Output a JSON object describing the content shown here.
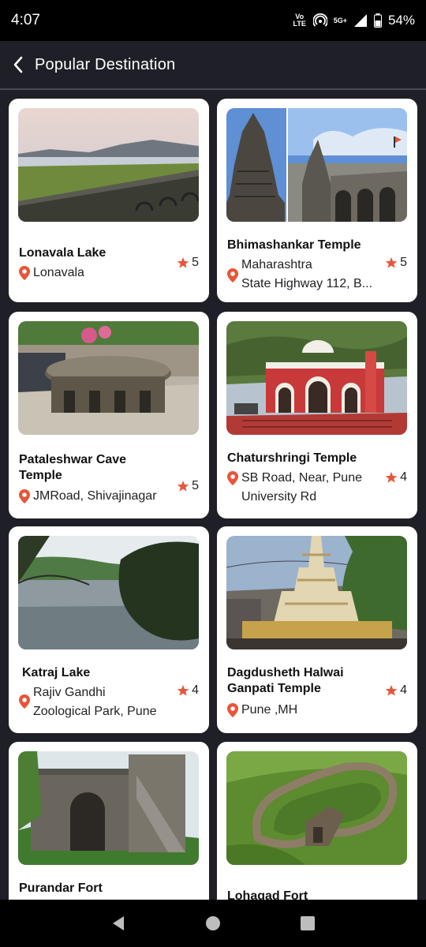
{
  "status": {
    "time": "4:07",
    "volte": "Vo LTE",
    "network": "5G+",
    "battery": "54%"
  },
  "header": {
    "title": "Popular Destination",
    "back_icon": "chevron-left-icon"
  },
  "colors": {
    "background": "#1f1f28",
    "card": "#ffffff",
    "accent": "#e8553a"
  },
  "destinations": [
    {
      "name": "Lonavala Lake",
      "location": "Lonavala",
      "rating": "5"
    },
    {
      "name": "Bhimashankar Temple",
      "location": "Maharashtra\nState Highway 112, B...",
      "rating": "5"
    },
    {
      "name": "Pataleshwar Cave Temple",
      "location": "JMRoad, Shivajinagar",
      "rating": "5"
    },
    {
      "name": "Chaturshringi Temple",
      "location": "SB Road, Near, Pune\nUniversity Rd",
      "rating": "4"
    },
    {
      "name": "Katraj Lake",
      "location": " Rajiv Gandhi\nZoological Park, Pune",
      "rating": "4"
    },
    {
      "name": "Dagdusheth Halwai Ganpati Temple",
      "location": "Pune ,MH",
      "rating": "4"
    },
    {
      "name": "Purandar Fort",
      "location": "",
      "rating": ""
    },
    {
      "name": "Lohagad Fort",
      "location": "",
      "rating": ""
    }
  ]
}
